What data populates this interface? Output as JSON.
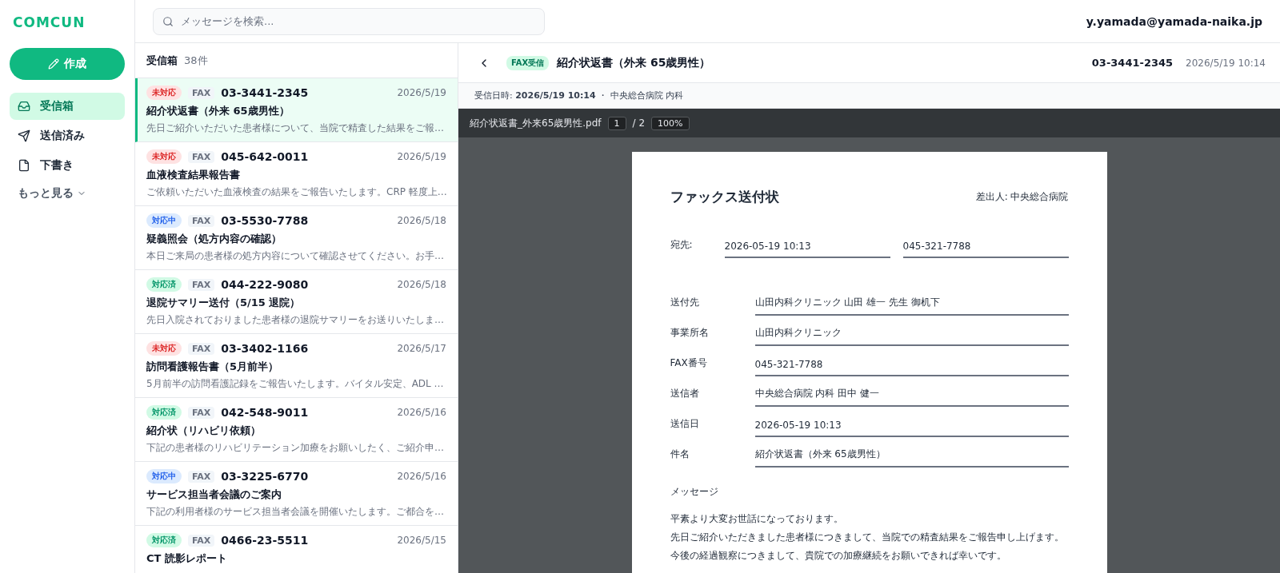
{
  "app": {
    "logo": "COMCUN",
    "compose": "作成",
    "user": "y.yamada@yamada-naika.jp"
  },
  "sidebar": {
    "items": [
      {
        "label": "受信箱",
        "kind": "inbox",
        "selected": true
      },
      {
        "label": "送信済み",
        "kind": "sent",
        "selected": false
      },
      {
        "label": "下書き",
        "kind": "drafts",
        "selected": false
      }
    ],
    "more": "もっと見る"
  },
  "search": {
    "placeholder": "メッセージを検索..."
  },
  "list": {
    "title": "受信箱",
    "count": "38件",
    "messages": [
      {
        "status": "未対応",
        "kind": "open",
        "channel": "FAX",
        "number": "03-3441-2345",
        "date": "2026/5/19",
        "subject": "紹介状返書（外来 65歳男性）",
        "preview": "先日ご紹介いただいた患者様について、当院で精査した結果をご報…",
        "selected": true
      },
      {
        "status": "未対応",
        "kind": "open",
        "channel": "FAX",
        "number": "045-642-0011",
        "date": "2026/5/19",
        "subject": "血液検査結果報告書",
        "preview": "ご依頼いただいた血液検査の結果をご報告いたします。CRP 軽度上…",
        "selected": false
      },
      {
        "status": "対応中",
        "kind": "progress",
        "channel": "FAX",
        "number": "03-5530-7788",
        "date": "2026/5/18",
        "subject": "疑義照会（処方内容の確認）",
        "preview": "本日ご来局の患者様の処方内容について確認させてください。お手…",
        "selected": false
      },
      {
        "status": "対応済",
        "kind": "done",
        "channel": "FAX",
        "number": "044-222-9080",
        "date": "2026/5/18",
        "subject": "退院サマリー送付（5/15 退院）",
        "preview": "先日入院されておりました患者様の退院サマリーをお送りいたしま…",
        "selected": false
      },
      {
        "status": "未対応",
        "kind": "open",
        "channel": "FAX",
        "number": "03-3402-1166",
        "date": "2026/5/17",
        "subject": "訪問看護報告書（5月前半）",
        "preview": "5月前半の訪問看護記録をご報告いたします。バイタル安定、ADL …",
        "selected": false
      },
      {
        "status": "対応済",
        "kind": "done",
        "channel": "FAX",
        "number": "042-548-9011",
        "date": "2026/5/16",
        "subject": "紹介状（リハビリ依頼）",
        "preview": "下記の患者様のリハビリテーション加療をお願いしたく、ご紹介申…",
        "selected": false
      },
      {
        "status": "対応中",
        "kind": "progress",
        "channel": "FAX",
        "number": "03-3225-6770",
        "date": "2026/5/16",
        "subject": "サービス担当者会議のご案内",
        "preview": "下記の利用者様のサービス担当者会議を開催いたします。ご都合を…",
        "selected": false
      },
      {
        "status": "対応済",
        "kind": "done",
        "channel": "FAX",
        "number": "0466-23-5511",
        "date": "2026/5/15",
        "subject": "CT 読影レポート",
        "selected": false
      }
    ]
  },
  "detail": {
    "tag": "FAX受信",
    "subject": "紹介状返書（外来 65歳男性）",
    "number": "03-3441-2345",
    "datetime": "2026/5/19 10:14",
    "received_label": "受信日時:",
    "received": "2026/5/19 10:14",
    "separator": "・",
    "sender": "中央総合病院 内科"
  },
  "pdf": {
    "filename": "紹介状返書_外来65歳男性.pdf",
    "page": "1",
    "pages": "/ 2",
    "zoom": "100%",
    "doc": {
      "title": "ファックス送付状",
      "from": "差出人: 中央総合病院",
      "to_label": "宛先:",
      "to_date": "2026-05-19 10:13",
      "to_number": "045-321-7788",
      "fields": [
        {
          "label": "送付先",
          "value": "山田内科クリニック 山田 雄一 先生 御机下"
        },
        {
          "label": "事業所名",
          "value": "山田内科クリニック"
        },
        {
          "label": "FAX番号",
          "value": "045-321-7788"
        },
        {
          "label": "送信者",
          "value": "中央総合病院 内科 田中 健一"
        },
        {
          "label": "送信日",
          "value": "2026-05-19 10:13"
        },
        {
          "label": "件名",
          "value": "紹介状返書（外来 65歳男性）"
        }
      ],
      "message_label": "メッセージ",
      "message": [
        "平素より大変お世話になっております。",
        "先日ご紹介いただきました患者様につきまして、当院での精査結果をご報告申し上げます。",
        "今後の経過観察につきまして、貴院での加療継続をお願いできれば幸いです。"
      ]
    }
  }
}
